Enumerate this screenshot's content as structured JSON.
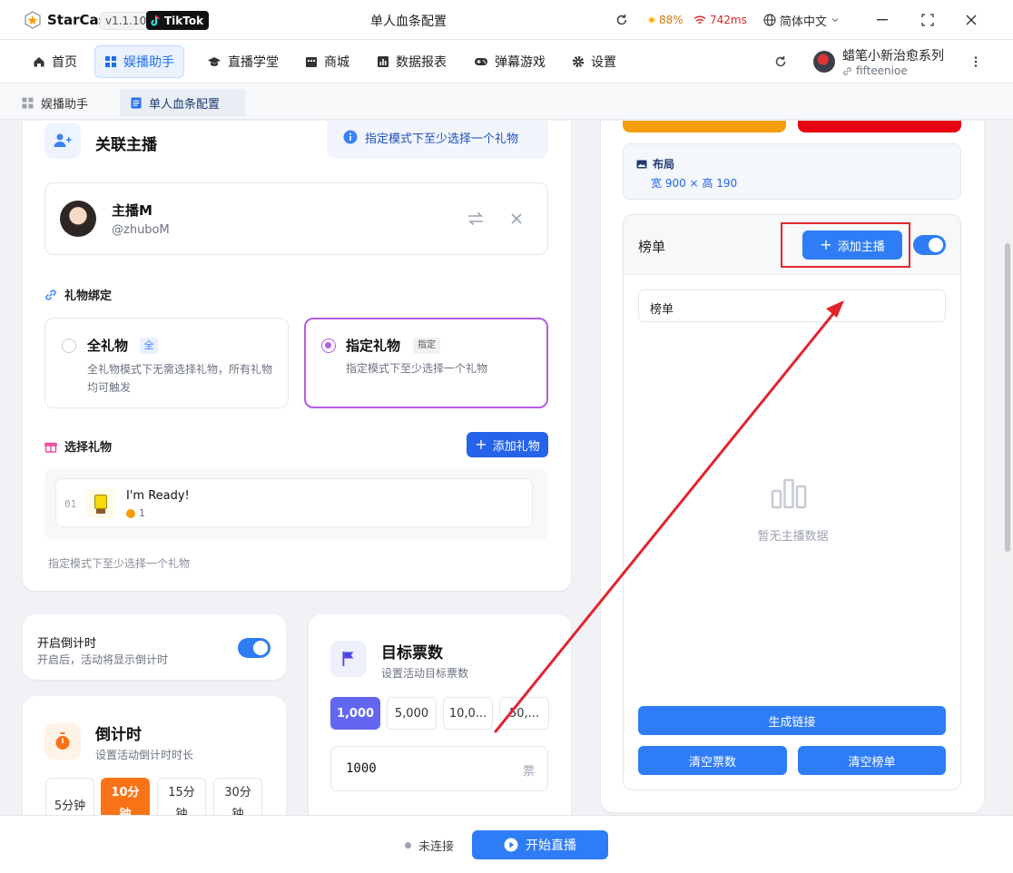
{
  "titlebar": {
    "app_name": "StarCast",
    "version": "v1.1.10",
    "platform": "TikTok",
    "window_title": "单人血条配置",
    "battery": "88%",
    "latency": "742ms",
    "language": "简体中文"
  },
  "nav": {
    "items": [
      {
        "label": "首页",
        "icon": "home-icon"
      },
      {
        "label": "娱播助手",
        "icon": "grid-icon"
      },
      {
        "label": "直播学堂",
        "icon": "graduation-cap-icon"
      },
      {
        "label": "商城",
        "icon": "store-icon"
      },
      {
        "label": "数据报表",
        "icon": "chart-icon"
      },
      {
        "label": "弹幕游戏",
        "icon": "gamepad-icon"
      },
      {
        "label": "设置",
        "icon": "gear-icon"
      }
    ],
    "user_name": "蜡笔小新治愈系列",
    "user_id": "fifteenioe"
  },
  "tabs": [
    {
      "label": "娱播助手"
    },
    {
      "label": "单人血条配置"
    }
  ],
  "anchor_card": {
    "title": "关联主播",
    "hint": "指定模式下至少选择一个礼物",
    "anchor_name": "主播M",
    "anchor_handle": "@zhuboM"
  },
  "gift_binding": {
    "title": "礼物绑定",
    "all": {
      "label": "全礼物",
      "badge": "全",
      "desc": "全礼物模式下无需选择礼物，所有礼物均可触发"
    },
    "specific": {
      "label": "指定礼物",
      "badge": "指定",
      "desc": "指定模式下至少选择一个礼物"
    }
  },
  "gift_select": {
    "title": "选择礼物",
    "add_label": "添加礼物",
    "items": [
      {
        "index": "01",
        "name": "I'm Ready!",
        "coins": "1"
      }
    ],
    "footer": "指定模式下至少选择一个礼物"
  },
  "countdown_toggle": {
    "title": "开启倒计时",
    "desc": "开启后，活动将显示倒计时"
  },
  "countdown": {
    "title": "倒计时",
    "desc": "设置活动倒计时时长",
    "options": [
      "5分钟",
      "10分钟",
      "15分钟",
      "30分钟"
    ],
    "selected": "10分钟"
  },
  "target_votes": {
    "title": "目标票数",
    "desc": "设置活动目标票数",
    "options": [
      "1,000",
      "5,000",
      "10,0...",
      "50,..."
    ],
    "selected": "1,000",
    "input_value": "1000",
    "unit": "票"
  },
  "layout_info": {
    "title": "布局",
    "size": "宽 900 × 高 190"
  },
  "ranking": {
    "title": "榜单",
    "add_label": "添加主播",
    "input_value": "榜单",
    "empty_text": "暂无主播数据",
    "generate_label": "生成链接",
    "clear_votes_label": "清空票数",
    "clear_list_label": "清空榜单"
  },
  "footer": {
    "status": "未连接",
    "start_label": "开始直播"
  },
  "colors": {
    "accent": "#2f7df6",
    "purple": "#b45ce8",
    "annotation_red": "#e1252e",
    "orange": "#f97316"
  }
}
